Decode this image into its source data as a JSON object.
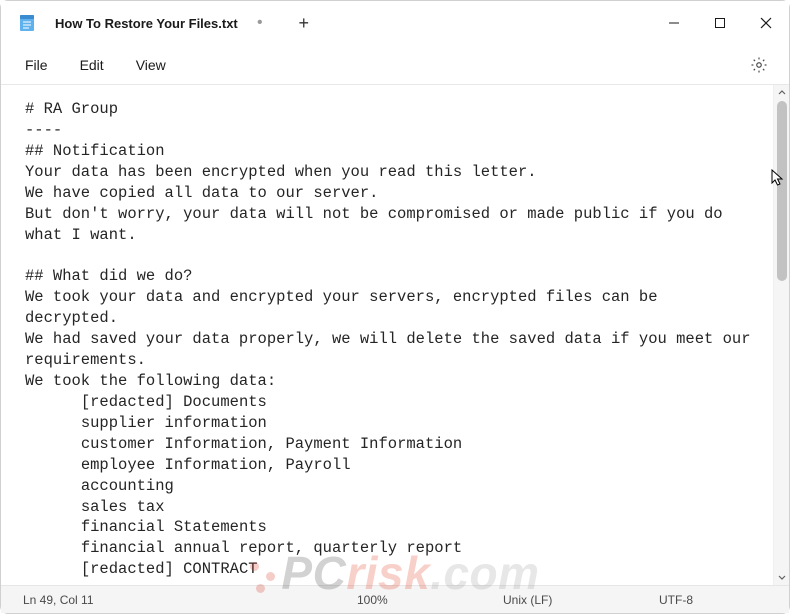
{
  "window": {
    "tab_title": "How To Restore Your Files.txt",
    "tab_modified_marker": "•",
    "new_tab_label": "+"
  },
  "menubar": {
    "file": "File",
    "edit": "Edit",
    "view": "View"
  },
  "document": {
    "text": "# RA Group\n----\n## Notification\nYour data has been encrypted when you read this letter.\nWe have copied all data to our server.\nBut don't worry, your data will not be compromised or made public if you do\nwhat I want.\n\n## What did we do?\nWe took your data and encrypted your servers, encrypted files can be\ndecrypted.\nWe had saved your data properly, we will delete the saved data if you meet our\nrequirements.\nWe took the following data:\n      [redacted] Documents\n      supplier information\n      customer Information, Payment Information\n      employee Information, Payroll\n      accounting\n      sales tax\n      financial Statements\n      financial annual report, quarterly report\n      [redacted] CONTRACT"
  },
  "statusbar": {
    "position": "Ln 49, Col 11",
    "zoom": "100%",
    "eol": "Unix (LF)",
    "encoding": "UTF-8"
  },
  "watermark": {
    "pc": "PC",
    "risk": "risk",
    "com": ".com"
  },
  "icons": {
    "app": "notepad-icon",
    "settings": "gear-icon",
    "minimize": "minimize-icon",
    "maximize": "maximize-icon",
    "close": "close-icon"
  }
}
